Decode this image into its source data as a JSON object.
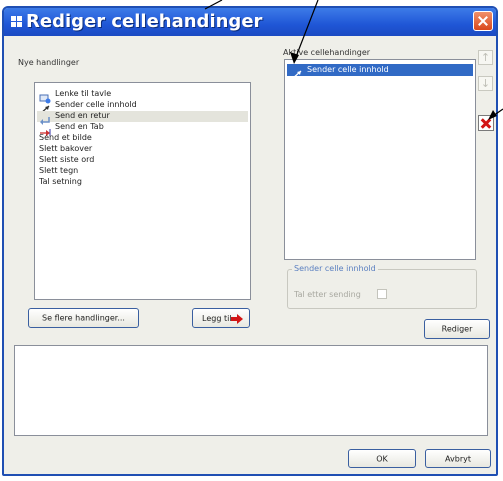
{
  "window": {
    "title": "Rediger cellehandinger"
  },
  "new_actions": {
    "label": "Nye handlinger",
    "items": [
      {
        "label": "Lenke til tavle",
        "icon": "board-link-icon"
      },
      {
        "label": "Sender celle innhold",
        "icon": "send-content-icon"
      },
      {
        "label": "Send en retur",
        "icon": "send-return-icon"
      },
      {
        "label": "Send en Tab",
        "icon": "send-tab-icon"
      },
      {
        "label": "Send et bilde"
      },
      {
        "label": "Slett bakover"
      },
      {
        "label": "Slett siste ord"
      },
      {
        "label": "Slett tegn"
      },
      {
        "label": "Tal setning"
      }
    ],
    "selected_index": 2,
    "more_button": "Se flere handlinger...",
    "add_button": "Legg til"
  },
  "active_actions": {
    "label": "Aktive cellehandinger",
    "items": [
      {
        "label": "Sender celle innhold",
        "icon": "send-content-icon"
      }
    ],
    "selected_index": 0
  },
  "details": {
    "group_title": "Sender celle innhold",
    "speak_after_label": "Tal etter sending",
    "speak_after_checked": false,
    "edit_button": "Rediger"
  },
  "footer": {
    "ok_button": "OK",
    "cancel_button": "Avbryt"
  },
  "colors": {
    "titlebar": "#1f56d6",
    "selection": "#316ac5",
    "accent_red": "#d21515"
  }
}
